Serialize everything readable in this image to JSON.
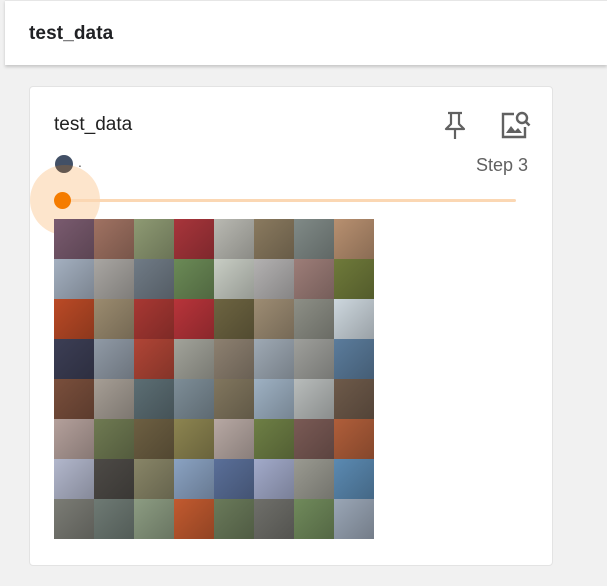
{
  "header": {
    "title": "test_data"
  },
  "card": {
    "title": "test_data",
    "run": {
      "name": ".",
      "color": "#425066"
    },
    "step_label": "Step 3",
    "slider": {
      "accent": "#f57c00",
      "value_fraction": 0.0
    },
    "icons": [
      "pin-icon",
      "image-search-icon"
    ]
  },
  "grid": {
    "rows": 8,
    "cols": 8,
    "cells": [
      [
        "#7a5b6f",
        "#a07262",
        "#8e9a73",
        "#a8353b",
        "#b9b9b2",
        "#8a7a5f",
        "#808a87",
        "#b89070"
      ],
      [
        "#a4b0c0",
        "#a9a6a2",
        "#707b86",
        "#6b8a56",
        "#c8cdc4",
        "#b3b1b1",
        "#9d7d78",
        "#6f7a3a"
      ],
      [
        "#bb4a26",
        "#9b8b6f",
        "#a83833",
        "#b8343a",
        "#6d6441",
        "#9d8c73",
        "#8d8f86",
        "#cdd7de"
      ],
      [
        "#3c3e55",
        "#909aa6",
        "#b04536",
        "#a2a39a",
        "#8d8070",
        "#9ea9b4",
        "#9e9f9b",
        "#5b7c9c"
      ],
      [
        "#7a4f3c",
        "#a69e95",
        "#5c6e74",
        "#7d8d97",
        "#81765e",
        "#9eb1c3",
        "#b8bcbb",
        "#6e5a4a"
      ],
      [
        "#b4a09b",
        "#6f7a52",
        "#6d5f42",
        "#8c8450",
        "#b7a8a3",
        "#6e7f45",
        "#7a5a55",
        "#b05e3a"
      ],
      [
        "#b2b7cc",
        "#4d4a46",
        "#888567",
        "#8aa2c2",
        "#5a6f99",
        "#a2aaca",
        "#9a9a91",
        "#5b8ab2"
      ],
      [
        "#7b7c75",
        "#6e7a74",
        "#8c9c82",
        "#c25a2f",
        "#6a7a5a",
        "#6f6f6a",
        "#708a5b",
        "#9aa6b6"
      ]
    ]
  }
}
